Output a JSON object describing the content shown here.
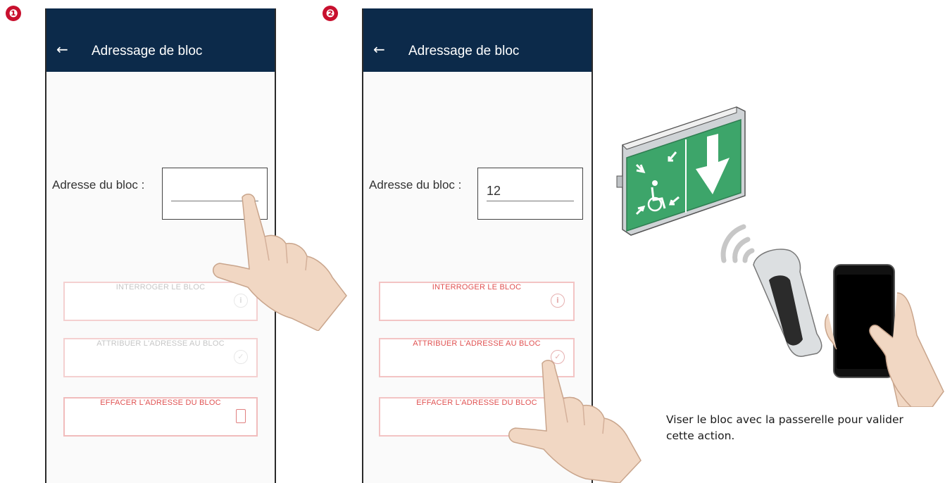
{
  "steps": [
    "❶",
    "❷"
  ],
  "screens": [
    {
      "appbar": {
        "back_icon": "←",
        "title": "Adressage de bloc"
      },
      "field": {
        "label": "Adresse du bloc :",
        "value": ""
      },
      "buttons": [
        {
          "label": "INTERROGER LE BLOC",
          "icon": "info-icon",
          "state": "disabled"
        },
        {
          "label": "ATTRIBUER L'ADRESSE AU BLOC",
          "icon": "check-icon",
          "state": "disabled"
        },
        {
          "label": "EFFACER L'ADRESSE DU BLOC",
          "icon": "trash-icon",
          "state": "enabled"
        }
      ]
    },
    {
      "appbar": {
        "back_icon": "←",
        "title": "Adressage de bloc"
      },
      "field": {
        "label": "Adresse du bloc :",
        "value": "12"
      },
      "buttons": [
        {
          "label": "INTERROGER LE BLOC",
          "icon": "info-icon",
          "state": "enabled"
        },
        {
          "label": "ATTRIBUER L'ADRESSE AU BLOC",
          "icon": "check-icon",
          "state": "enabled"
        },
        {
          "label": "EFFACER L'ADRESSE DU BLOC",
          "icon": "trash-icon",
          "state": "enabled"
        }
      ]
    }
  ],
  "caption": "Viser le bloc avec la passerelle pour valider cette action.",
  "colors": {
    "appbar": "#0c2a4a",
    "button_text": "#e05252",
    "button_text_disabled": "#bdbdbd",
    "badge": "#c8102e",
    "sign_green": "#3da56a"
  }
}
